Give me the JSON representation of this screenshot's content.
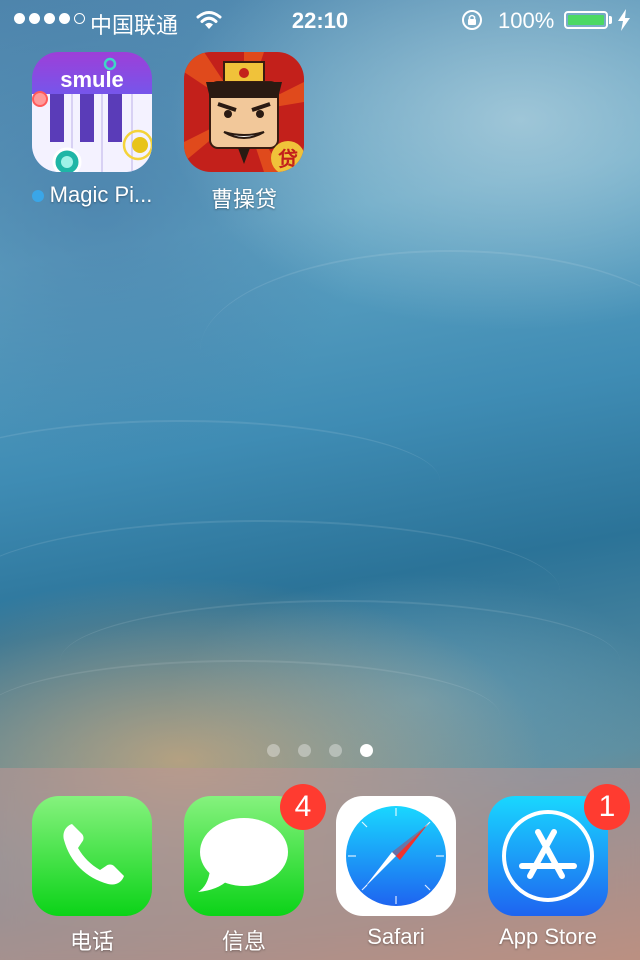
{
  "status_bar": {
    "carrier": "中国联通",
    "time": "22:10",
    "battery_percent": "100%",
    "signal_bars_filled": 4,
    "signal_bars_total": 5,
    "battery_level": 1.0,
    "battery_color": "#4cd964"
  },
  "home_apps": [
    {
      "label": "Magic Pi...",
      "icon": "smule-magic-piano-icon",
      "has_new_indicator": true
    },
    {
      "label": "曹操贷",
      "icon": "caocao-loan-icon"
    }
  ],
  "page_indicator": {
    "count": 4,
    "active_index": 3
  },
  "dock_apps": [
    {
      "label": "电话",
      "icon": "phone-icon",
      "badge": ""
    },
    {
      "label": "信息",
      "icon": "messages-icon",
      "badge": "4"
    },
    {
      "label": "Safari",
      "icon": "safari-compass-icon",
      "badge": ""
    },
    {
      "label": "App Store",
      "icon": "app-store-icon",
      "badge": "1"
    }
  ],
  "colors": {
    "badge": "#ff3b30",
    "phone_green": "#4cd964",
    "safari_blue": "#1a8cff"
  }
}
